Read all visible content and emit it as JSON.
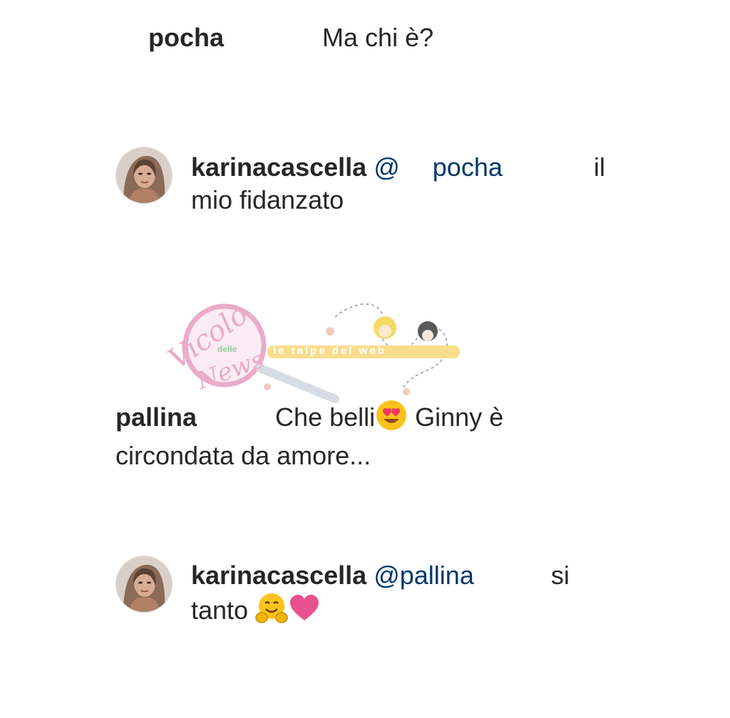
{
  "comments": [
    {
      "username": "pocha",
      "text": "Ma chi è?"
    },
    {
      "username": "karinacascella",
      "mention": "@",
      "mention_name": "pocha",
      "text1": "il",
      "text2": "mio fidanzato"
    },
    {
      "username": "pallina",
      "text1": "Che belli",
      "text2": "Ginny è",
      "text3": "circondata da amore..."
    },
    {
      "username": "karinacascella",
      "mention": "@pallina",
      "text1": "si",
      "text2": "tanto"
    }
  ],
  "watermark": {
    "line1": "Vicolo",
    "line2": "delle",
    "line3": "News",
    "banner": "le talpe del web"
  },
  "colors": {
    "mention": "#00376b",
    "username": "#262626",
    "heart": "#e8508e",
    "emoji": "#f7b500",
    "watermark_pink": "#e79ec0"
  }
}
